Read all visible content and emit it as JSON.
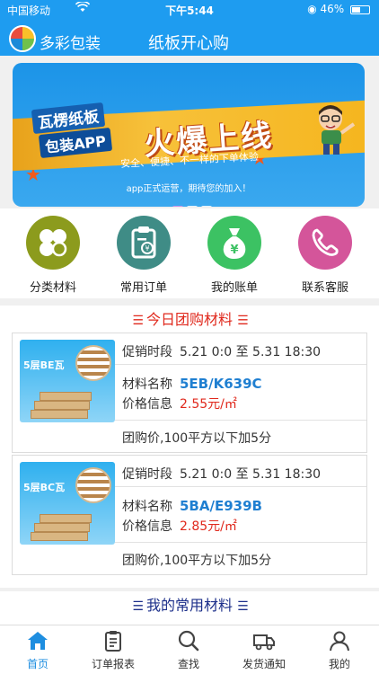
{
  "status": {
    "carrier": "中国移动",
    "time": "下午5:44",
    "battery": "46%"
  },
  "header": {
    "brand": "多彩包装",
    "title": "纸板开心购"
  },
  "banner": {
    "tag1": "瓦楞纸板",
    "tag2": "包装APP",
    "headline": "火爆上线",
    "subtitle": "安全、便捷、不一样的下单体验",
    "footer": "app正式运营，期待您的加入！"
  },
  "quick_nav": [
    {
      "label": "分类材料",
      "color": "#8c9b1d",
      "icon": "clover-icon"
    },
    {
      "label": "常用订单",
      "color": "#3f8c86",
      "icon": "clipboard-icon"
    },
    {
      "label": "我的账单",
      "color": "#3cc263",
      "icon": "money-bag-icon"
    },
    {
      "label": "联系客服",
      "color": "#d4559a",
      "icon": "phone-icon"
    }
  ],
  "group_buy": {
    "title": "今日团购材料",
    "items": [
      {
        "thumb_label": "5层BE瓦",
        "period_label": "促销时段",
        "period_value": "5.21 0:0 至 5.31 18:30",
        "name_label": "材料名称",
        "name_value": "5EB/K639C",
        "price_label": "价格信息",
        "price_value": "2.55元/㎡",
        "note": "团购价,100平方以下加5分"
      },
      {
        "thumb_label": "5层BC瓦",
        "period_label": "促销时段",
        "period_value": "5.21 0:0 至 5.31 18:30",
        "name_label": "材料名称",
        "name_value": "5BA/E939B",
        "price_label": "价格信息",
        "price_value": "2.85元/㎡",
        "note": "团购价,100平方以下加5分"
      }
    ]
  },
  "common_materials": {
    "title": "我的常用材料"
  },
  "tabs": [
    {
      "label": "首页",
      "icon": "home-icon",
      "active": true
    },
    {
      "label": "订单报表",
      "icon": "report-icon",
      "active": false
    },
    {
      "label": "查找",
      "icon": "search-icon",
      "active": false
    },
    {
      "label": "发货通知",
      "icon": "truck-icon",
      "active": false
    },
    {
      "label": "我的",
      "icon": "user-icon",
      "active": false
    }
  ],
  "colors": {
    "primary": "#1e9cf0",
    "title_red": "#e0281c",
    "title_navy": "#1c2f8a"
  }
}
